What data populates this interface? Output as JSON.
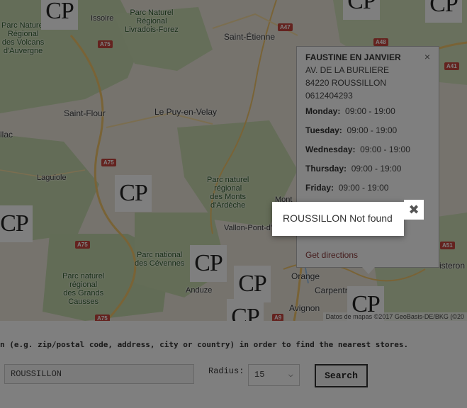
{
  "map": {
    "places": {
      "issoire": "Issoire",
      "st_etienne": "Saint-Étienne",
      "st_flour": "Saint-Flour",
      "le_puy": "Le Puy-en-Velay",
      "aurillac": "llac",
      "laguiole": "Laguiole",
      "vallon": "Vallon-Pont-d'",
      "anduze": "Anduze",
      "orange": "Orange",
      "carpentras": "Carpentr",
      "avignon": "Avignon",
      "sisteron": "isteron",
      "mont": "Mont",
      "park_volcans": "Parc Naturel\nRégional\ndes Volcans\nd'Auvergne",
      "park_livradois": "Parc Naturel\nRégional\nLivradois-Forez",
      "park_monts": "Parc naturel\nrégional\ndes Monts\nd'Ardèche",
      "park_cevennes": "Parc national\ndes Cévennes",
      "park_causses": "Parc naturel\nrégional\ndes Grands\nCausses"
    },
    "shields": [
      "A75",
      "A47",
      "A48",
      "A41",
      "A75",
      "A75",
      "A75",
      "A9",
      "A51"
    ],
    "marker_text": "CP",
    "attribution": "Datos de mapas ©2017 GeoBasis-DE/BKG (©20"
  },
  "info_window": {
    "name": "FAUSTINE EN JANVIER",
    "address_line1": "AV. DE LA BURLIERE",
    "address_line2": "84220 ROUSSILLON",
    "phone": "0612404293",
    "hours": [
      {
        "day": "Monday:",
        "time": "09:00 - 19:00"
      },
      {
        "day": "Tuesday:",
        "time": "09:00 - 19:00"
      },
      {
        "day": "Wednesday:",
        "time": "09:00 - 19:00"
      },
      {
        "day": "Thursday:",
        "time": "09:00 - 19:00"
      },
      {
        "day": "Friday:",
        "time": "09:00 - 19:00"
      }
    ],
    "directions_label": "Get directions",
    "close_glyph": "×"
  },
  "form": {
    "instruction": "n (e.g. zip/postal code, address, city or country) in order to find the nearest stores.",
    "address_value": "ROUSSILLON",
    "radius_label": "Radius:",
    "radius_value": "15",
    "search_label": "Search"
  },
  "alert": {
    "message": "ROUSSILLON Not found",
    "close_glyph": "✖"
  },
  "colors": {
    "overlay": "#000000",
    "marker_bg": "#ffffff",
    "directions_link": "#8a3a3a"
  }
}
